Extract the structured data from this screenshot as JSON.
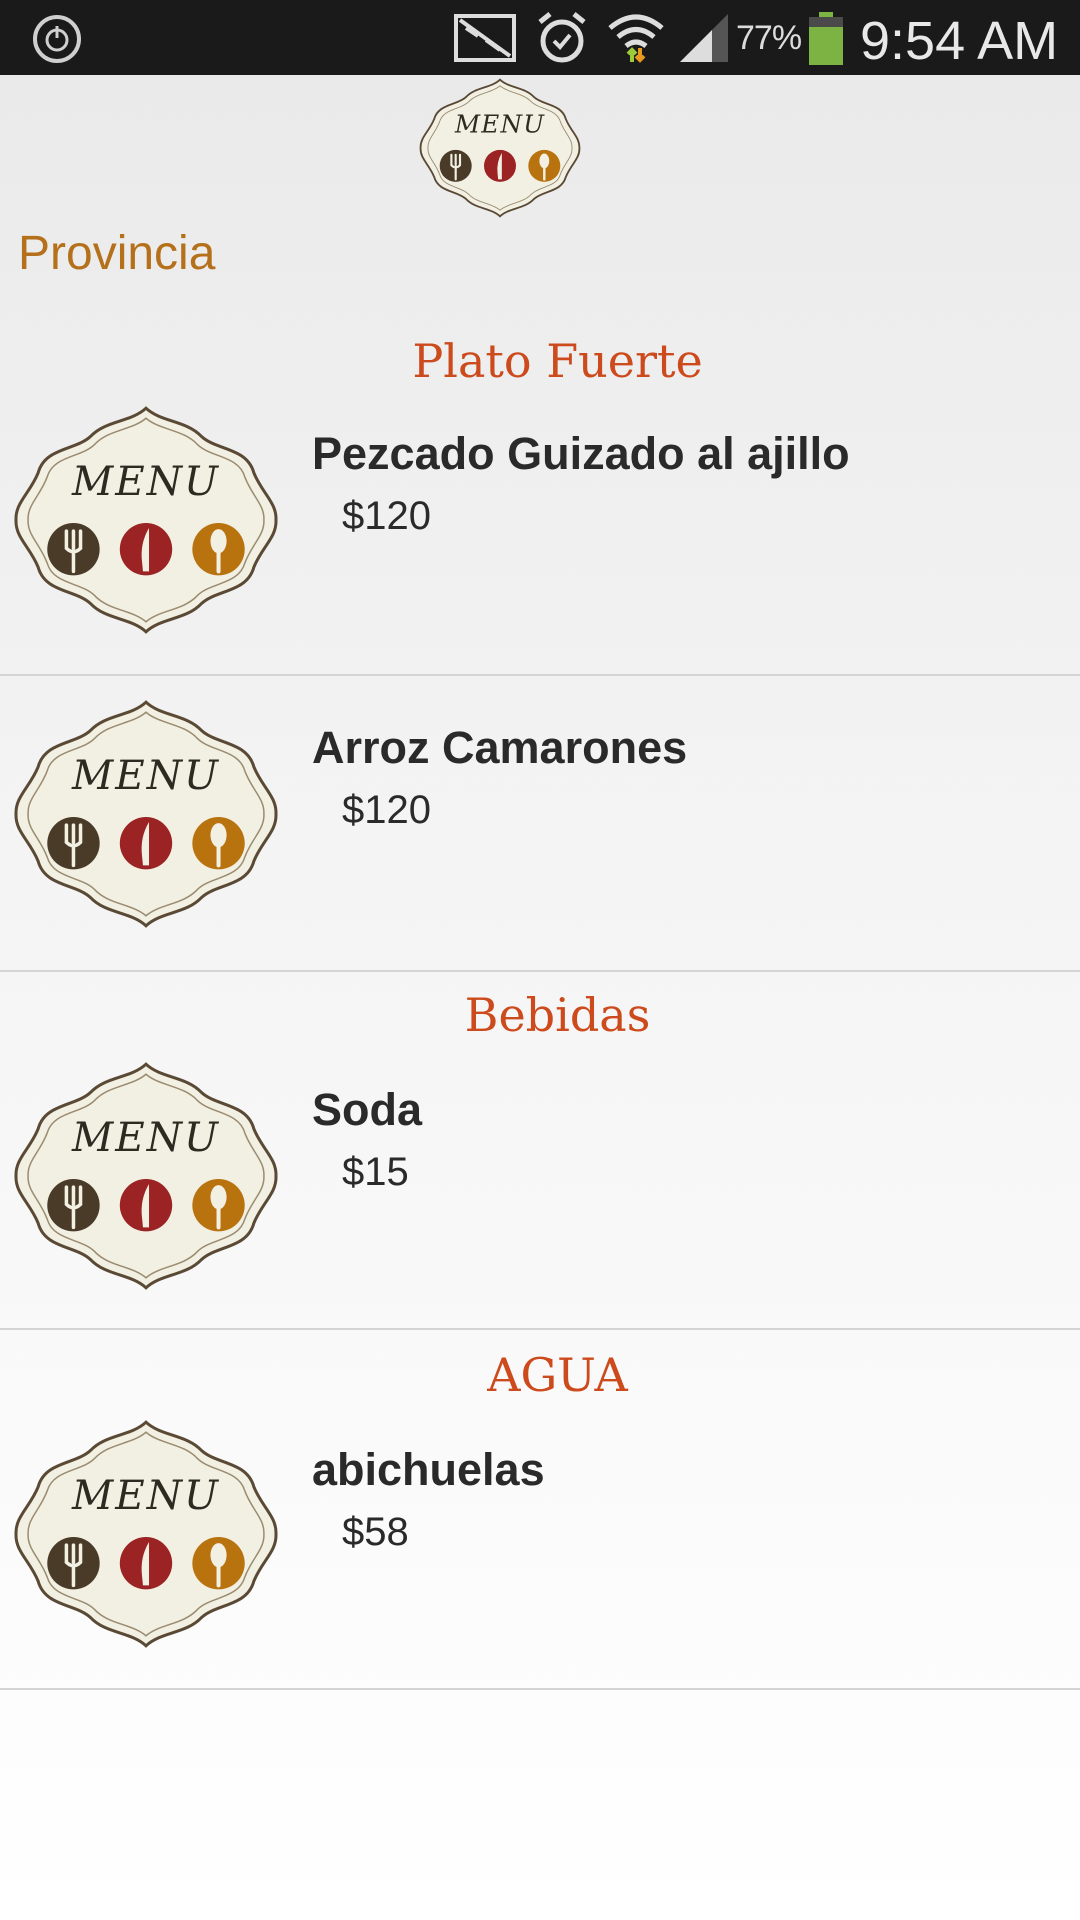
{
  "status_bar": {
    "icons": [
      "power-icon",
      "no-sim-icon",
      "alarm-icon",
      "wifi-icon",
      "signal-icon",
      "battery-icon"
    ],
    "battery_percent": "77%",
    "time": "9:54 AM"
  },
  "header": {
    "logo_text": "MENU",
    "store_name": "Provincia"
  },
  "sections": [
    {
      "title": "Plato Fuerte",
      "items": [
        {
          "name": "Pezcado Guizado al ajillo",
          "price": "$120"
        },
        {
          "name": "Arroz Camarones",
          "price": "$120"
        }
      ]
    },
    {
      "title": "Bebidas",
      "items": [
        {
          "name": "Soda",
          "price": "$15"
        }
      ]
    },
    {
      "title": "AGUA",
      "items": [
        {
          "name": "abichuelas",
          "price": "$58"
        }
      ]
    }
  ],
  "colors": {
    "status_bar": "#1a1a1a",
    "store_name": "#b5701c",
    "section_title": "#cc4a1c",
    "item_text": "#2a2a2a",
    "battery": "#7cb342"
  }
}
